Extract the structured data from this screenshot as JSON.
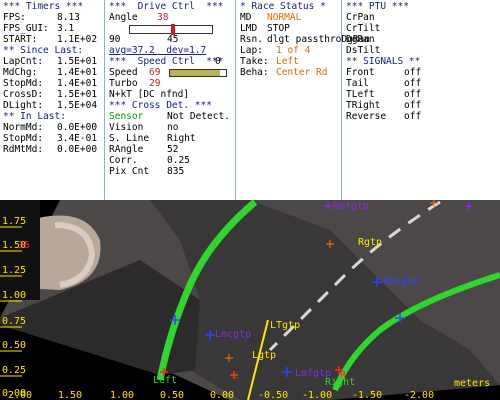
{
  "timers": {
    "title": "*** Timers ***",
    "fps_label": "FPS:",
    "fps_value": "8.13",
    "fpsgui_label": "FPS_GUI:",
    "fpsgui_value": "3.1",
    "start_label": "START:",
    "start_value": "1.1E+02",
    "since_title": "** Since Last:",
    "lapcnt_label": "LapCnt:",
    "lapcnt_value": "1.5E+01",
    "mdchg_label": "MdChg:",
    "mdchg_value": "1.4E+01",
    "stopmd_label": "StopMd:",
    "stopmd_value": "1.4E+01",
    "crossd_label": "CrossD:",
    "crossd_value": "1.5E+01",
    "dlight_label": "DLight:",
    "dlight_value": "1.5E+04",
    "inlast_title": "** In Last:",
    "normmd_label": "NormMd:",
    "normmd_value": "0.0E+00",
    "stopmd2_label": "StopMd:",
    "stopmd2_value": "3.4E-01",
    "rdmtmd_label": "RdMtMd:",
    "rdmtmd_value": "0.0E+00"
  },
  "drive": {
    "title": "***  Drive Ctrl  ***",
    "angle_label": "Angle",
    "angle_value": "38",
    "slider_min": "90",
    "slider_max": "0",
    "slider_value": "45",
    "avg_text": "avg=37.2  dev=1.7",
    "speed_title": "***  Speed Ctrl  ***",
    "speed_label": "Speed",
    "speed_value": "69",
    "turbo_label": "Turbo",
    "turbo_value": "29",
    "nkt_text": "N+kT [DC nfnd]",
    "crossdet_title": "*** Cross Det. ***",
    "sensor_label": "Sensor",
    "sensor_value": "Not Detect.",
    "vision_label": "Vision",
    "vision_value": "no",
    "sline_label": "S. Line",
    "sline_value": "Right",
    "rangle_label": "RAngle",
    "rangle_value": "52",
    "corr_label": "Corr.",
    "corr_value": "0.25",
    "pixcnt_label": "Pix Cnt",
    "pixcnt_value": "835",
    "speed_fraction": 0.9
  },
  "race": {
    "title": "* Race Status *",
    "md_label": "MD",
    "md_value": "NORMAL",
    "lmd_label": "LMD",
    "lmd_value": "STOP",
    "rsn_label": "Rsn.",
    "rsn_value": "dlgt passthroDgRan",
    "lap_label": "Lap:",
    "lap_value": "1 of 4",
    "take_label": "Take:",
    "take_value": "Left",
    "beha_label": "Beha:",
    "beha_value": "Center Rd"
  },
  "ptu": {
    "title": "*** PTU ***",
    "items": [
      "CrPan",
      "CrTilt",
      "DgRan",
      "DsTilt"
    ],
    "signals_title": "** SIGNALS **",
    "signals": [
      {
        "label": "Front",
        "value": "off"
      },
      {
        "label": "Tail",
        "value": "off"
      },
      {
        "label": "TLeft",
        "value": "off"
      },
      {
        "label": "TRight",
        "value": "off"
      },
      {
        "label": "Reverse",
        "value": "off"
      }
    ]
  },
  "camera": {
    "y_ticks": [
      "1.75",
      "1.50",
      "1.25",
      "1.00",
      "0.75",
      "0.50",
      "0.25",
      "0.00"
    ],
    "x_ticks": [
      "2.00",
      "1.50",
      "1.00",
      "0.50",
      "0.00",
      "-0.50",
      "-1.00",
      "-1.50",
      "-2.00"
    ],
    "units": "meters",
    "labels": {
      "rmfgtp": "Rmfgtp",
      "rgtp": "Rgtp",
      "rmcgtp": "Rmcgtp",
      "lmcgtp": "Lmcgtp",
      "ltgtp": "LTgtp",
      "lgtp": "Lgtp",
      "lmfgtp": "Lmfgtp",
      "left": "Left",
      "right": "Right",
      "r": "R",
      "l": "L",
      "red_035": "35"
    }
  }
}
